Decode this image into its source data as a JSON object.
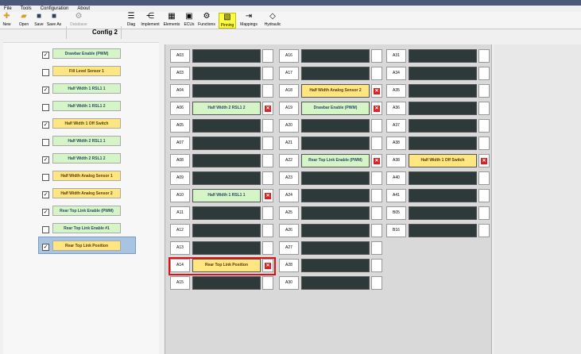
{
  "menu": [
    "File",
    "Tools",
    "Configuration",
    "About"
  ],
  "toolbar": {
    "new": "New",
    "open": "Open",
    "save": "Save",
    "save_as": "Save As",
    "database": "Database",
    "config": "Config 2",
    "diag": "Diag",
    "implement": "Implement",
    "elements": "Elements",
    "ecus": "ECUs",
    "functions": "Functions",
    "pinning": "Pinning",
    "mappings": "Mappings",
    "hydraulic": "Hydraulic"
  },
  "left_items": [
    {
      "label": "Drawbar Enable (PWM)",
      "checked": true,
      "color": "green"
    },
    {
      "label": "Fill Level Sensor 1",
      "checked": false,
      "color": "yellow"
    },
    {
      "label": "Half Width 1 RSL1 1",
      "checked": true,
      "color": "green"
    },
    {
      "label": "Half Width 1 RSL1 2",
      "checked": false,
      "color": "green"
    },
    {
      "label": "Half Width 1 Off Switch",
      "checked": true,
      "color": "yellow"
    },
    {
      "label": "Half Width 2 RSL1 1",
      "checked": false,
      "color": "green"
    },
    {
      "label": "Half Width 2 RSL1 2",
      "checked": true,
      "color": "green"
    },
    {
      "label": "Half Width Analog Sensor 1",
      "checked": false,
      "color": "yellow"
    },
    {
      "label": "Half Width Analog Sensor 2",
      "checked": true,
      "color": "yellow"
    },
    {
      "label": "Rear Top Link Enable (PWM)",
      "checked": true,
      "color": "green"
    },
    {
      "label": "Rear Top Link Enable #1",
      "checked": false,
      "color": "green"
    },
    {
      "label": "Rear Top Link Position",
      "checked": true,
      "color": "yellow"
    }
  ],
  "columns": [
    [
      {
        "pin": "A03",
        "value": "",
        "color": ""
      },
      {
        "pin": "A03",
        "value": "",
        "color": ""
      },
      {
        "pin": "A04",
        "value": "",
        "color": ""
      },
      {
        "pin": "A06",
        "value": "Half Width 2 RSL1 2",
        "color": "green"
      },
      {
        "pin": "A05",
        "value": "",
        "color": ""
      },
      {
        "pin": "A07",
        "value": "",
        "color": ""
      },
      {
        "pin": "A08",
        "value": "",
        "color": ""
      },
      {
        "pin": "A09",
        "value": "",
        "color": ""
      },
      {
        "pin": "A10",
        "value": "Half Width 1 RSL1 1",
        "color": "green"
      },
      {
        "pin": "A11",
        "value": "",
        "color": ""
      },
      {
        "pin": "A12",
        "value": "",
        "color": ""
      },
      {
        "pin": "A13",
        "value": "",
        "color": ""
      },
      {
        "pin": "A14",
        "value": "Rear Top Link Position",
        "color": "yellow"
      },
      {
        "pin": "A15",
        "value": "",
        "color": ""
      }
    ],
    [
      {
        "pin": "A16",
        "value": "",
        "color": ""
      },
      {
        "pin": "A17",
        "value": "",
        "color": ""
      },
      {
        "pin": "A18",
        "value": "Half Width Analog Sensor 2",
        "color": "yellow"
      },
      {
        "pin": "A19",
        "value": "Drawbar Enable (PWM)",
        "color": "green"
      },
      {
        "pin": "A20",
        "value": "",
        "color": ""
      },
      {
        "pin": "A21",
        "value": "",
        "color": ""
      },
      {
        "pin": "A22",
        "value": "Rear Top Link Enable (PWM)",
        "color": "green"
      },
      {
        "pin": "A23",
        "value": "",
        "color": ""
      },
      {
        "pin": "A24",
        "value": "",
        "color": ""
      },
      {
        "pin": "A25",
        "value": "",
        "color": ""
      },
      {
        "pin": "A26",
        "value": "",
        "color": ""
      },
      {
        "pin": "A27",
        "value": "",
        "color": ""
      },
      {
        "pin": "A28",
        "value": "",
        "color": ""
      },
      {
        "pin": "A30",
        "value": "",
        "color": ""
      }
    ],
    [
      {
        "pin": "A31",
        "value": "",
        "color": ""
      },
      {
        "pin": "A34",
        "value": "",
        "color": ""
      },
      {
        "pin": "A35",
        "value": "",
        "color": ""
      },
      {
        "pin": "A36",
        "value": "",
        "color": ""
      },
      {
        "pin": "A37",
        "value": "",
        "color": ""
      },
      {
        "pin": "A38",
        "value": "",
        "color": ""
      },
      {
        "pin": "A38",
        "value": "Half Width 1 Off Switch",
        "color": "yellow"
      },
      {
        "pin": "A40",
        "value": "",
        "color": ""
      },
      {
        "pin": "A41",
        "value": "",
        "color": ""
      },
      {
        "pin": "B05",
        "value": "",
        "color": ""
      },
      {
        "pin": "B16",
        "value": "",
        "color": ""
      }
    ]
  ],
  "highlighted_slot": "A14"
}
